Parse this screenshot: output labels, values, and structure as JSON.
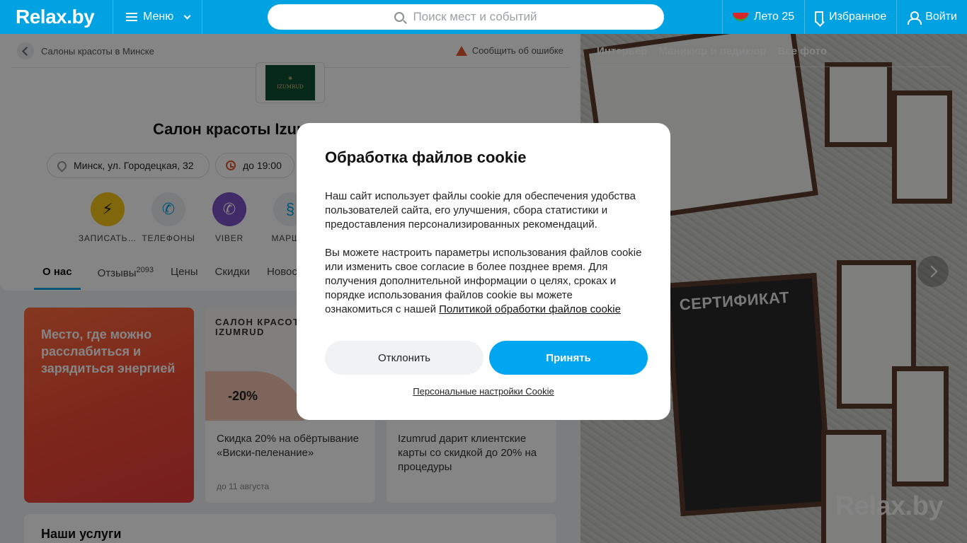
{
  "header": {
    "logo": "Relax.by",
    "menu_label": "Меню",
    "search_placeholder": "Поиск мест и событий",
    "summer_label": "Лето 25",
    "favorites_label": "Избранное",
    "login_label": "Войти",
    "colors": {
      "header_bg": "#00a2e2"
    }
  },
  "page": {
    "breadcrumb": "Салоны красоты в Минске",
    "report_error": "Сообщить об ошибке",
    "salon_logo_text": "IZUMRUD",
    "title": "Салон красоты Izumrud (Изумруд)",
    "address": "Минск, ул. Городецкая, 32",
    "hours": "до 19:00",
    "actions": [
      {
        "label": "ЗАПИСАТЬ…",
        "icon": "booking-icon"
      },
      {
        "label": "ТЕЛЕФОНЫ",
        "icon": "phone-icon"
      },
      {
        "label": "VIBER",
        "icon": "viber-icon"
      },
      {
        "label": "МАРШ…",
        "icon": "route-icon"
      }
    ],
    "tabs": [
      {
        "label": "О нас"
      },
      {
        "label": "Отзывы",
        "count": "2093"
      },
      {
        "label": "Цены"
      },
      {
        "label": "Скидки"
      },
      {
        "label": "Новост"
      }
    ]
  },
  "promos": {
    "highlight": "Место, где можно расслабиться и зарядиться энергией",
    "card1": {
      "header": "САЛОН КРАСОТ\nIZUMRUD",
      "discount": "-20%",
      "text": "Скидка 20% на обёртывание «Виски-пеленание»",
      "date": "до 11 августа"
    },
    "card2": {
      "text": "Izumrud дарит клиентские карты со скидкой до 20% на процедуры"
    }
  },
  "services_title": "Наши услуги",
  "gallery": {
    "tabs": [
      "Интерьер",
      "Маникюр и педикюр",
      "Все фото"
    ],
    "certificate_text": "СЕРТИФИКАТ",
    "watermark": "Relax.by"
  },
  "cookie_modal": {
    "title": "Обработка файлов cookie",
    "paragraph1": "Наш сайт использует файлы cookie для обеспечения удобства пользователей сайта, его улучшения, сбора статистики и предоставления персонализированных рекомендаций.",
    "paragraph2": "Вы можете настроить параметры использования файлов cookie или изменить свое согласие в более позднее время. Для получения дополнительной информации о целях, сроках и порядке использования файлов cookie вы можете ознакомиться с нашей",
    "policy_link": "Политикой обработки файлов cookie",
    "decline_label": "Отклонить",
    "accept_label": "Принять",
    "settings_link": "Персональные настройки Cookie",
    "colors": {
      "accept_bg": "#00a6f0"
    }
  }
}
